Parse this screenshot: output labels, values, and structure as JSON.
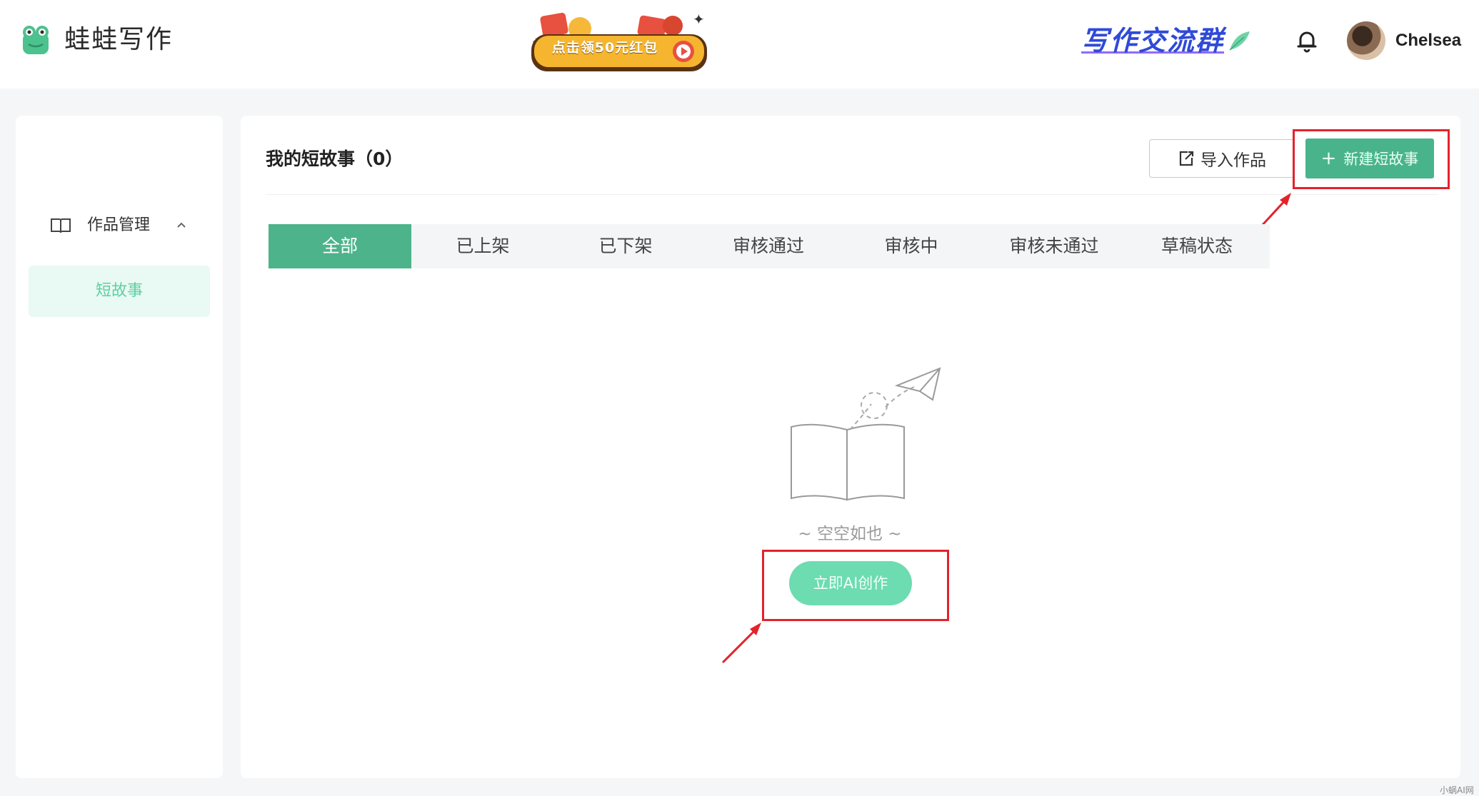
{
  "header": {
    "brand": "蛙蛙写作",
    "banner_text": "点击领50元红包",
    "community_link": "写作交流群",
    "user_name": "Chelsea",
    "icons": {
      "logo": "frog-logo-icon",
      "bell": "bell-icon",
      "leaf": "feather-icon"
    }
  },
  "sidebar": {
    "group_label": "作品管理",
    "items": [
      {
        "label": "短故事",
        "active": true
      }
    ]
  },
  "main": {
    "title": "我的短故事（0）",
    "import_button": "导入作品",
    "new_button": "新建短故事",
    "tabs": [
      {
        "label": "全部",
        "active": true
      },
      {
        "label": "已上架"
      },
      {
        "label": "已下架"
      },
      {
        "label": "审核通过"
      },
      {
        "label": "审核中"
      },
      {
        "label": "审核未通过"
      },
      {
        "label": "草稿状态"
      }
    ],
    "empty_text": "~ 空空如也 ~",
    "ai_button": "立即AI创作"
  },
  "colors": {
    "accent": "#4cb38b",
    "accent_light": "#6ddcb0",
    "highlight": "#e3232b",
    "link": "#2f4ad8"
  },
  "watermark": "小蜗AI网"
}
